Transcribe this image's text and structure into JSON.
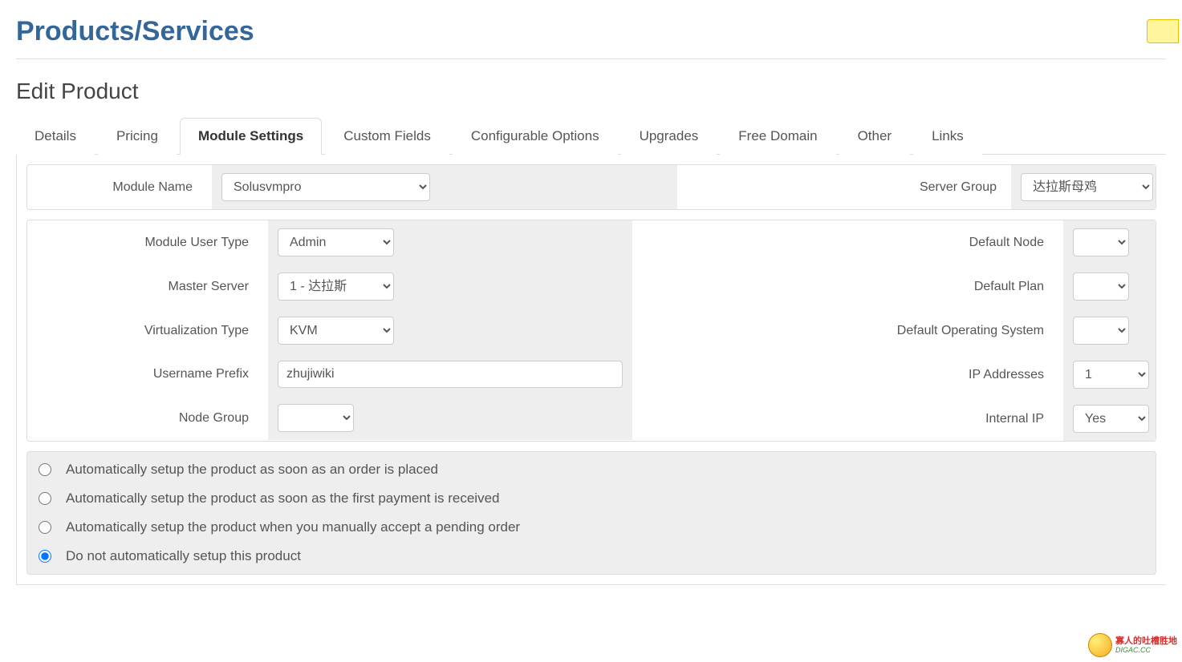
{
  "page": {
    "title": "Products/Services",
    "section": "Edit Product"
  },
  "tabs": {
    "details": "Details",
    "pricing": "Pricing",
    "module": "Module Settings",
    "custom": "Custom Fields",
    "config": "Configurable Options",
    "upgrades": "Upgrades",
    "freedomain": "Free Domain",
    "other": "Other",
    "links": "Links"
  },
  "top": {
    "module_label": "Module Name",
    "module_value": "Solusvmpro",
    "group_label": "Server Group",
    "group_value": "达拉斯母鸡"
  },
  "left": {
    "user_type_label": "Module User Type",
    "user_type_value": "Admin",
    "master_label": "Master Server",
    "master_value": "1 - 达拉斯",
    "virt_label": "Virtualization Type",
    "virt_value": "KVM",
    "prefix_label": "Username Prefix",
    "prefix_value": "zhujiwiki",
    "nodegroup_label": "Node Group",
    "nodegroup_value": ""
  },
  "right": {
    "node_label": "Default Node",
    "node_value": "",
    "plan_label": "Default Plan",
    "plan_value": "",
    "os_label": "Default Operating System",
    "os_value": "",
    "ip_label": "IP Addresses",
    "ip_value": "1",
    "intip_label": "Internal IP",
    "intip_value": "Yes"
  },
  "setup": {
    "opt1": "Automatically setup the product as soon as an order is placed",
    "opt2": "Automatically setup the product as soon as the first payment is received",
    "opt3": "Automatically setup the product when you manually accept a pending order",
    "opt4": "Do not automatically setup this product",
    "selected": "opt4"
  },
  "watermark": {
    "line1": "寡人的吐槽胜地",
    "line2": "DIGAC.CC"
  }
}
